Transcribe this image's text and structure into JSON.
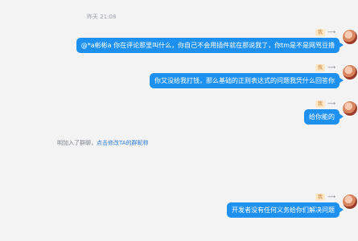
{
  "timestamp": "昨天 21:08",
  "badge": "我",
  "reply_icon": "reply-arrow-icon",
  "messages": [
    {
      "text": "@*a彬彬a 你在评论那里叫什么，你自己不会用插件就在那说我了，你tm是不是网骂豆撸"
    },
    {
      "text": "你又没给我打钱，那么基础的正则表达式的问题我凭什么回答你"
    },
    {
      "text": "给你能的"
    },
    {
      "text": "开发者没有任何义务给你们解决问题"
    }
  ],
  "system_notice": {
    "prefix": "明加入了群聊，",
    "link": "点击修改TA的群昵称"
  },
  "colors": {
    "bubble": "#1e90ef",
    "background": "#f3f3f4",
    "link": "#2f7ed8"
  }
}
